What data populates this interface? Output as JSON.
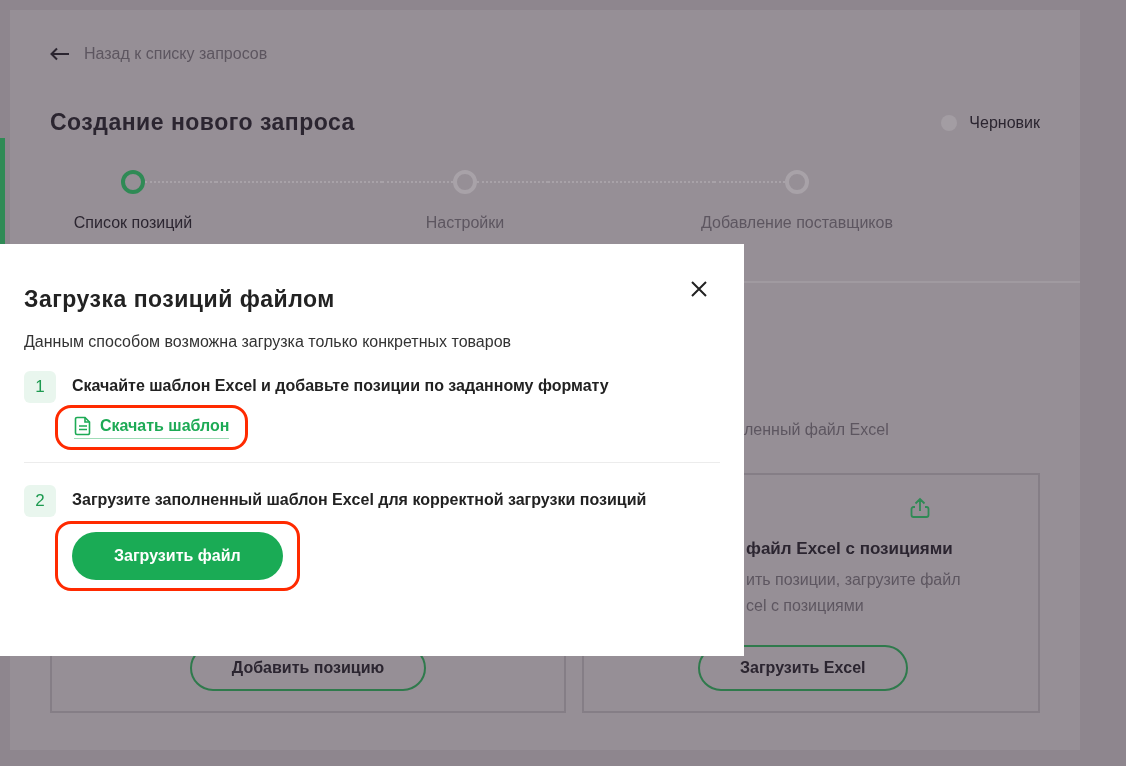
{
  "page": {
    "back_link": "Назад к списку запросов",
    "title": "Создание нового запроса",
    "status": "Черновик",
    "steps": [
      {
        "label": "Список позиций",
        "selected": true
      },
      {
        "label": "Настройки",
        "selected": false
      },
      {
        "label": "Добавление поставщиков",
        "selected": false
      }
    ],
    "section_hint": "ленный файл Excel",
    "cards": [
      {
        "button": "Добавить позицию"
      },
      {
        "title": "файл Excel с позициями",
        "description_lines": [
          "ить позиции, загрузите файл",
          "cel с позициями"
        ],
        "button": "Загрузить Excel"
      }
    ]
  },
  "modal": {
    "title": "Загрузка позиций файлом",
    "subtitle": "Данным способом возможна загрузка только конкретных товаров",
    "steps": [
      {
        "number": "1",
        "text": "Скачайте шаблон Excel и добавьте позиции по заданному формату",
        "kind": "link",
        "action": "Скачать шаблон",
        "highlighted": true
      },
      {
        "number": "2",
        "text": "Загрузите заполненный шаблон Excel для корректной загрузки позиций",
        "kind": "button",
        "action": "Загрузить файл",
        "highlighted": true
      }
    ]
  }
}
